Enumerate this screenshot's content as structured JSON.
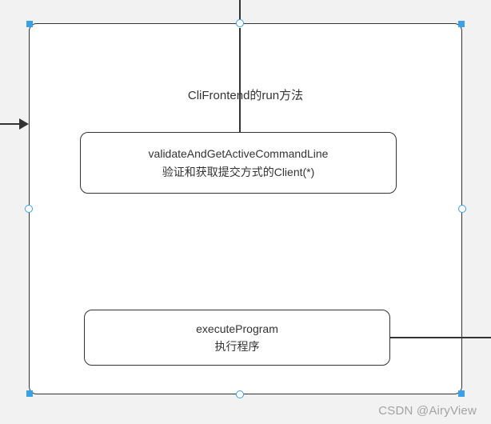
{
  "outer": {
    "title": "CliFrontend的run方法"
  },
  "nodes": {
    "validate": {
      "line1": "validateAndGetActiveCommandLine",
      "line2": "验证和获取提交方式的Client(*)"
    },
    "execute": {
      "line1": "executeProgram",
      "line2": "执行程序"
    }
  },
  "watermark": "CSDN @AiryView"
}
